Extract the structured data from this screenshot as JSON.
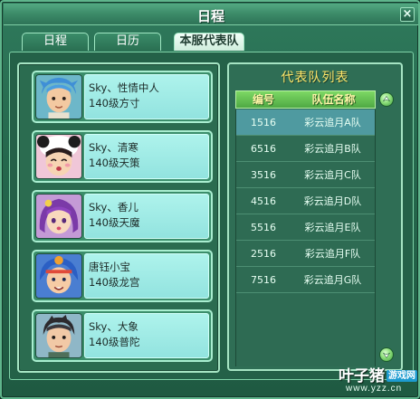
{
  "window": {
    "title": "日程"
  },
  "tabs": [
    {
      "label": "日程",
      "active": false
    },
    {
      "label": "日历",
      "active": false
    },
    {
      "label": "本服代表队",
      "active": true
    }
  ],
  "members": [
    {
      "name": "Sky、性情中人",
      "detail": "140级方寸",
      "avatar": "boy-blue-hair-avatar"
    },
    {
      "name": "Sky、清寒",
      "detail": "140级天策",
      "avatar": "girl-panda-hat-avatar"
    },
    {
      "name": "Sky、香儿",
      "detail": "140级天魔",
      "avatar": "girl-purple-hair-avatar"
    },
    {
      "name": "唐钰小宝",
      "detail": "140级龙宫",
      "avatar": "boy-blue-hair-headband-avatar"
    },
    {
      "name": "Sky、大象",
      "detail": "140级普陀",
      "avatar": "boy-dark-hair-avatar"
    }
  ],
  "team_list": {
    "title": "代表队列表",
    "columns": [
      "编号",
      "队伍名称"
    ],
    "rows": [
      {
        "id": "1516",
        "name": "彩云追月A队",
        "selected": true
      },
      {
        "id": "6516",
        "name": "彩云追月B队",
        "selected": false
      },
      {
        "id": "3516",
        "name": "彩云追月C队",
        "selected": false
      },
      {
        "id": "4516",
        "name": "彩云追月D队",
        "selected": false
      },
      {
        "id": "5516",
        "name": "彩云追月E队",
        "selected": false
      },
      {
        "id": "2516",
        "name": "彩云追月F队",
        "selected": false
      },
      {
        "id": "7516",
        "name": "彩云追月G队",
        "selected": false
      }
    ]
  },
  "icons": {
    "close": "close-icon",
    "scroll_up": "scroll-up-icon",
    "scroll_down": "scroll-down-icon"
  },
  "watermark": {
    "brand": "叶子猪",
    "badge": "游戏网",
    "url": "www.yzz.cn"
  },
  "colors": {
    "accent": "#ffe76a",
    "header": "#7dd864",
    "selected_row": "#4f9aa0",
    "info_bg": "#aef3ec"
  }
}
